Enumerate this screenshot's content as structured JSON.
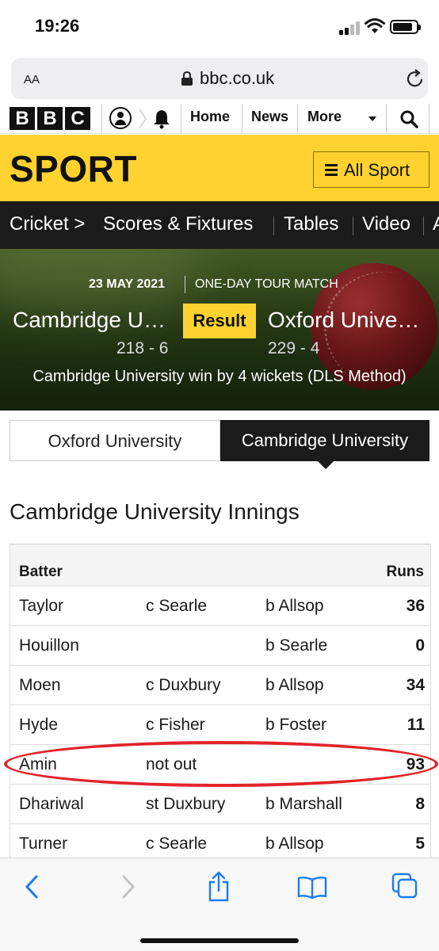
{
  "status_bar": {
    "time": "19:26"
  },
  "url_bar": {
    "text_size_label": "AA",
    "url": "bbc.co.uk"
  },
  "bbc_nav": {
    "logo_letters": [
      "B",
      "B",
      "C"
    ],
    "links": [
      "Home",
      "News",
      "More"
    ]
  },
  "sport_header": {
    "title": "SPORT",
    "all_sport_label": "All Sport"
  },
  "sub_nav": {
    "section": "Cricket >",
    "items": [
      "Scores & Fixtures",
      "Tables",
      "Video",
      "A"
    ]
  },
  "match": {
    "date": "23 MAY 2021",
    "type": "ONE-DAY TOUR MATCH",
    "home_team": "Cambridge U…",
    "away_team": "Oxford Unive…",
    "status": "Result",
    "home_score": "218 - 6",
    "away_score": "229 - 4",
    "summary": "Cambridge University win by 4 wickets (DLS Method)"
  },
  "tabs": {
    "left": "Oxford University",
    "right": "Cambridge University"
  },
  "innings": {
    "title": "Cambridge University Innings",
    "headers": {
      "batter": "Batter",
      "runs": "Runs"
    },
    "rows": [
      {
        "batter": "Taylor",
        "dismissal": "c Searle",
        "bowler": "b Allsop",
        "runs": "36"
      },
      {
        "batter": "Houillon",
        "dismissal": "",
        "bowler": "b Searle",
        "runs": "0"
      },
      {
        "batter": "Moen",
        "dismissal": "c Duxbury",
        "bowler": "b Allsop",
        "runs": "34"
      },
      {
        "batter": "Hyde",
        "dismissal": "c Fisher",
        "bowler": "b Foster",
        "runs": "11"
      },
      {
        "batter": "Amin",
        "dismissal": "not out",
        "bowler": "",
        "runs": "93"
      },
      {
        "batter": "Dhariwal",
        "dismissal": "st Duxbury",
        "bowler": "b Marshall",
        "runs": "8"
      },
      {
        "batter": "Turner",
        "dismissal": "c Searle",
        "bowler": "b Allsop",
        "runs": "5"
      }
    ]
  },
  "colors": {
    "sport_yellow": "#ffd230",
    "nav_dark": "#1b1b1b",
    "highlight_red": "#e2232a",
    "safari_blue": "#1a7cf5"
  },
  "toolbar_icons": [
    "back-icon",
    "forward-icon",
    "share-icon",
    "bookmarks-icon",
    "tabs-icon"
  ]
}
